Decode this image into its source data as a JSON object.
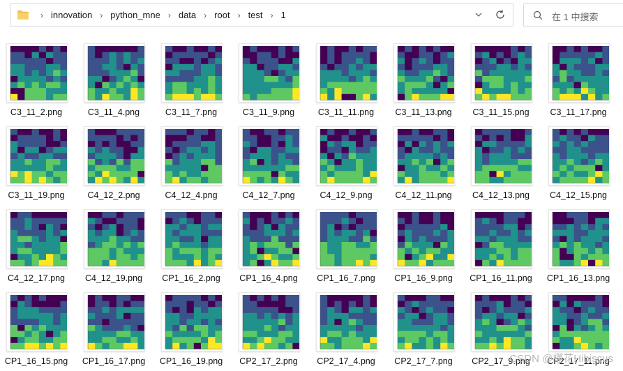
{
  "address_bar": {
    "breadcrumbs": [
      "innovation",
      "python_mne",
      "data",
      "root",
      "test",
      "1"
    ]
  },
  "search": {
    "placeholder": "在 1 中搜索"
  },
  "files": [
    "C3_11_2.png",
    "C3_11_4.png",
    "C3_11_7.png",
    "C3_11_9.png",
    "C3_11_11.png",
    "C3_11_13.png",
    "C3_11_15.png",
    "C3_11_17.png",
    "C3_11_19.png",
    "C4_12_2.png",
    "C4_12_4.png",
    "C4_12_7.png",
    "C4_12_9.png",
    "C4_12_11.png",
    "C4_12_13.png",
    "C4_12_15.png",
    "C4_12_17.png",
    "C4_12_19.png",
    "CP1_16_2.png",
    "CP1_16_4.png",
    "CP1_16_7.png",
    "CP1_16_9.png",
    "CP1_16_11.png",
    "CP1_16_13.png",
    "CP1_16_15.png",
    "CP1_16_17.png",
    "CP1_16_19.png",
    "CP2_17_2.png",
    "CP2_17_4.png",
    "CP2_17_7.png",
    "CP2_17_9.png",
    "CP2_17_11.png"
  ],
  "watermark": "CSDN @槿花Hibiscus",
  "colors": {
    "viridis": [
      "#440154",
      "#3b528b",
      "#21918c",
      "#5ec962",
      "#fde725"
    ]
  }
}
